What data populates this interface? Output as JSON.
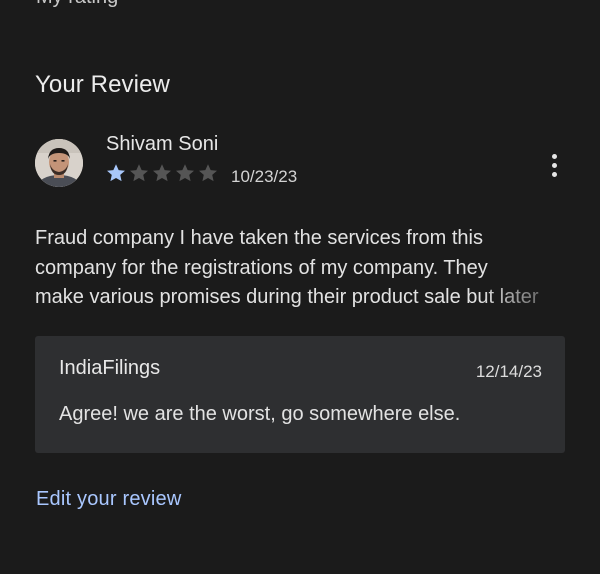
{
  "colors": {
    "background": "#1b1b1b",
    "reply_background": "#2e2f31",
    "star_filled": "#a8c7fa",
    "star_empty": "#555555",
    "link": "#a9c7ff"
  },
  "top": {
    "cutoff_text": "My rating"
  },
  "review_section": {
    "title": "Your Review",
    "reviewer": {
      "name": "Shivam Soni",
      "avatar_icon": "user-avatar-photo"
    },
    "rating": {
      "value": 1,
      "max": 5
    },
    "date": "10/23/23",
    "more_icon": "more-vert-icon",
    "text": "Fraud company I have taken the services from this\ncompany for the registrations of my company. They\nmake various promises during their product sale but later"
  },
  "developer_reply": {
    "author": "IndiaFilings",
    "date": "12/14/23",
    "text": "Agree! we are the worst, go somewhere else."
  },
  "actions": {
    "edit_label": "Edit your review"
  }
}
